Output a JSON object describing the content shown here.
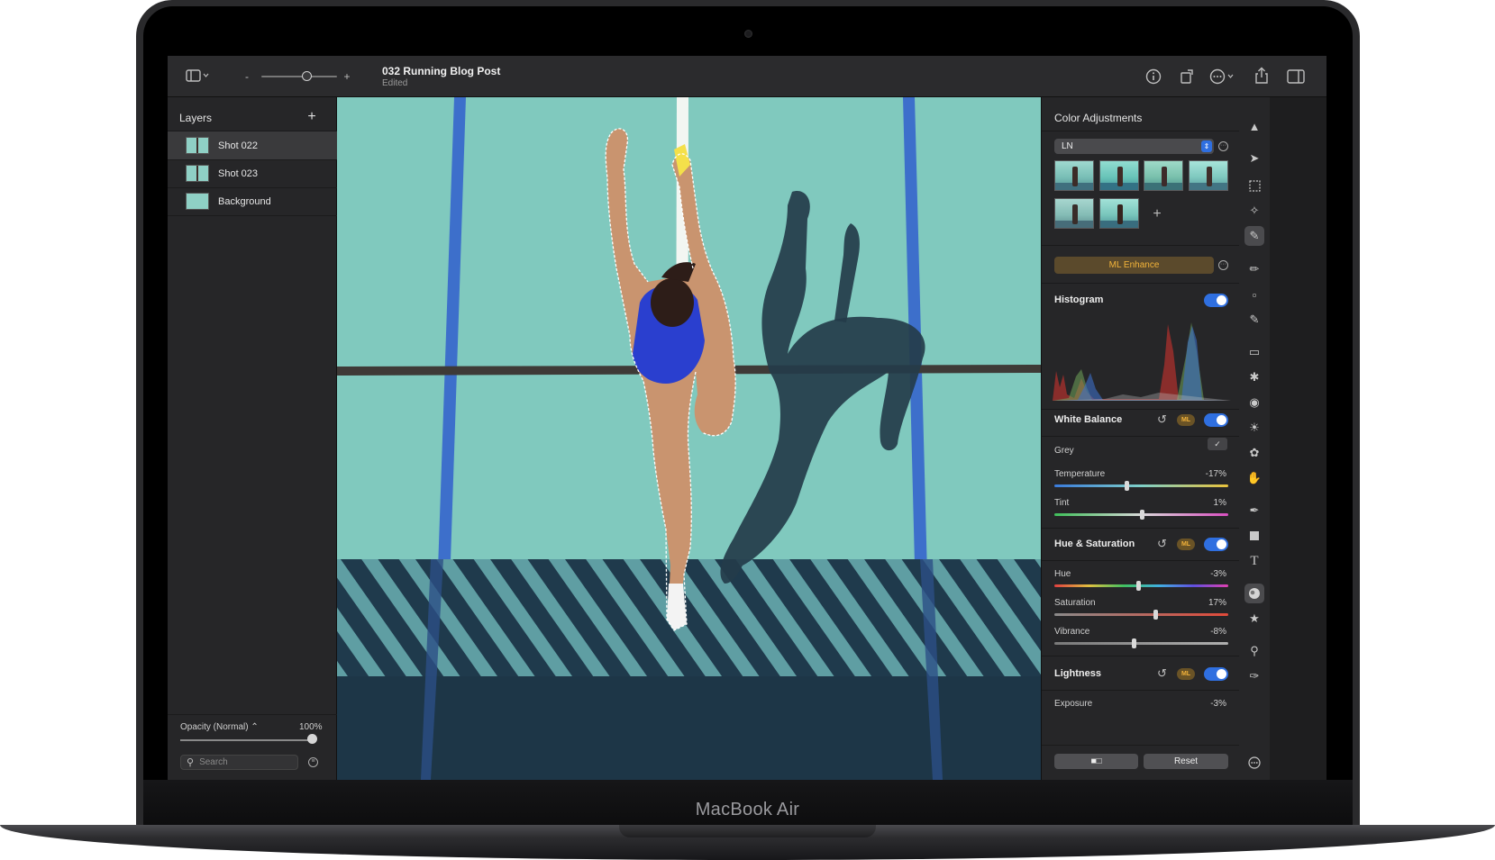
{
  "device": {
    "brand_label": "MacBook Air"
  },
  "toolbar": {
    "doc_title": "032 Running Blog Post",
    "doc_subtitle": "Edited",
    "zoom_minus": "-",
    "zoom_plus": "+"
  },
  "layers": {
    "title": "Layers",
    "add": "+",
    "items": [
      {
        "name": "Shot 022",
        "selected": true
      },
      {
        "name": "Shot 023",
        "selected": false
      },
      {
        "name": "Background",
        "selected": false
      }
    ],
    "opacity_label": "Opacity (Normal) ⌃",
    "opacity_value": "100%",
    "opacity_level": 1.0,
    "search_placeholder": "Search"
  },
  "adjustments": {
    "title": "Color Adjustments",
    "preset_select": "LN",
    "preset_add": "+",
    "ml_enhance": "ML Enhance",
    "ml_badge": "ML",
    "histogram": {
      "title": "Histogram"
    },
    "white_balance": {
      "title": "White Balance",
      "grey_label": "Grey",
      "temperature": {
        "label": "Temperature",
        "value": "-17%",
        "level": 0.415
      },
      "tint": {
        "label": "Tint",
        "value": "1%",
        "level": 0.505
      }
    },
    "hue_saturation": {
      "title": "Hue & Saturation",
      "hue": {
        "label": "Hue",
        "value": "-3%",
        "level": 0.485
      },
      "saturation": {
        "label": "Saturation",
        "value": "17%",
        "level": 0.585
      },
      "vibrance": {
        "label": "Vibrance",
        "value": "-8%",
        "level": 0.46
      }
    },
    "lightness": {
      "title": "Lightness",
      "exposure": {
        "label": "Exposure",
        "value": "-3%"
      }
    },
    "compare_button": "■□",
    "reset_button": "Reset"
  },
  "colors": {
    "accent": "#2f6fe0",
    "ml_gold": "#f3b43a",
    "track_teal": "#7fc7bc",
    "lane_blue": "#3a6cc8"
  }
}
